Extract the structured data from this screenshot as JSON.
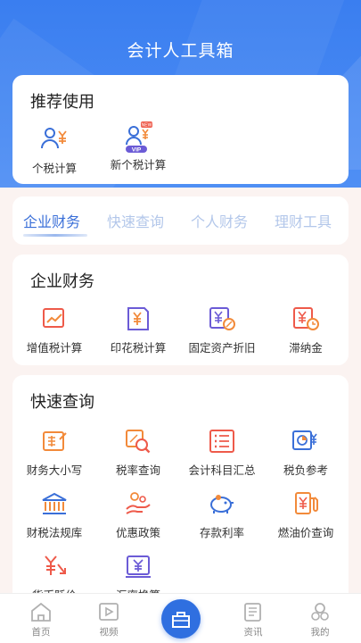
{
  "header": {
    "title": "会计人工具箱"
  },
  "recommend": {
    "title": "推荐使用",
    "items": [
      {
        "label": "个税计算",
        "icon": "person-yuan-icon"
      },
      {
        "label": "新个税计算",
        "icon": "person-yuan-vip-icon",
        "badge": "NEW",
        "vip": "VIP"
      }
    ]
  },
  "tabs": [
    {
      "label": "企业财务",
      "active": true
    },
    {
      "label": "快速查询",
      "active": false
    },
    {
      "label": "个人财务",
      "active": false
    },
    {
      "label": "理财工具",
      "active": false
    }
  ],
  "enterprise": {
    "title": "企业财务",
    "items": [
      {
        "label": "增值税计算",
        "icon": "chart-up-icon"
      },
      {
        "label": "印花税计算",
        "icon": "stamp-yuan-icon"
      },
      {
        "label": "固定资产折旧",
        "icon": "asset-percent-icon"
      },
      {
        "label": "滞纳金",
        "icon": "yuan-clock-icon"
      }
    ]
  },
  "quick": {
    "title": "快速查询",
    "items": [
      {
        "label": "财务大小写",
        "icon": "pencil-doc-icon"
      },
      {
        "label": "税率查询",
        "icon": "magnifier-percent-icon"
      },
      {
        "label": "会计科目汇总",
        "icon": "list-icon"
      },
      {
        "label": "税负参考",
        "icon": "pie-yuan-icon"
      },
      {
        "label": "财税法规库",
        "icon": "building-icon"
      },
      {
        "label": "优惠政策",
        "icon": "hand-coins-icon"
      },
      {
        "label": "存款利率",
        "icon": "piggy-bank-icon"
      },
      {
        "label": "燃油价查询",
        "icon": "fuel-pump-icon"
      },
      {
        "label": "货币贬价",
        "icon": "yuan-down-icon"
      },
      {
        "label": "汇率换算",
        "icon": "exchange-yuan-icon"
      }
    ]
  },
  "tabbar": [
    {
      "label": "首页",
      "icon": "home-icon"
    },
    {
      "label": "视频",
      "icon": "video-icon"
    },
    {
      "label": "",
      "icon": "toolbox-icon"
    },
    {
      "label": "资讯",
      "icon": "news-icon"
    },
    {
      "label": "我的",
      "icon": "profile-icon"
    }
  ],
  "colors": {
    "primary": "#3a7ef0",
    "accent_blue": "#3a6fd8",
    "icon_orange": "#f28a3a",
    "icon_purple": "#6b5bd6",
    "icon_red": "#ee5a4a"
  }
}
